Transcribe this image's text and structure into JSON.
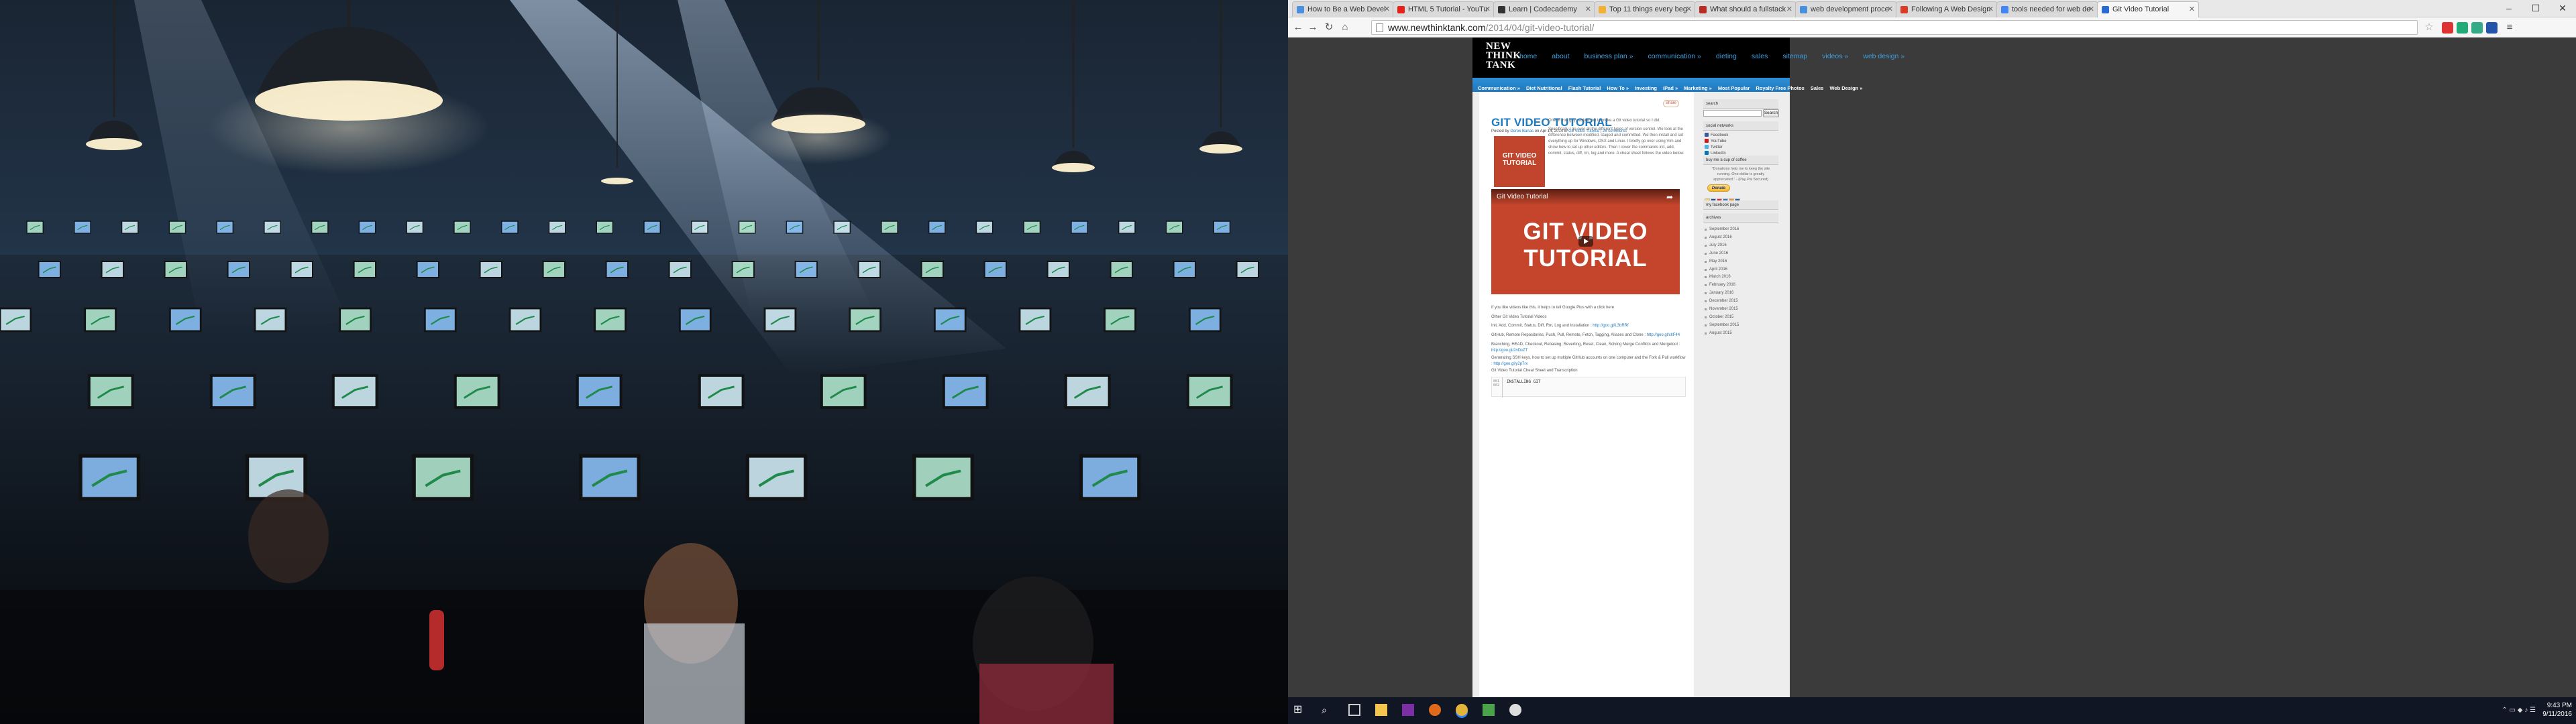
{
  "browser": {
    "tabs": [
      {
        "title": "How to Be a Web Devel",
        "favicon_color": "#4a8fe0"
      },
      {
        "title": "HTML 5 Tutorial - YouTu",
        "favicon_color": "#e62117"
      },
      {
        "title": "Learn | Codecademy",
        "favicon_color": "#333333"
      },
      {
        "title": "Top 11 things every beg",
        "favicon_color": "#f2b134"
      },
      {
        "title": "What should a fullstack",
        "favicon_color": "#b92b27"
      },
      {
        "title": "web development proce",
        "favicon_color": "#4a8fe0"
      },
      {
        "title": "Following A Web Design",
        "favicon_color": "#d93d26"
      },
      {
        "title": "tools needed for web de",
        "favicon_color": "#4285f4"
      },
      {
        "title": "Git Video Tutorial",
        "favicon_color": "#2a6ad6"
      }
    ],
    "url_host": "www.newthinktank.com",
    "url_path": "/2014/04/git-video-tutorial/"
  },
  "site": {
    "logo_lines": [
      "NEW",
      "THINK",
      "TANK"
    ],
    "top_nav": [
      "home",
      "about",
      "business plan »",
      "communication »",
      "dieting",
      "sales",
      "sitemap",
      "videos »",
      "web design »"
    ],
    "sub_nav": [
      "Communication »",
      "Diet Nutritional",
      "Flash Tutorial",
      "How To »",
      "Investing",
      "iPad »",
      "Marketing »",
      "Most Popular",
      "Royalty Free Photos",
      "Sales",
      "Web Design »"
    ],
    "share_label": "Share",
    "post": {
      "title": "GIT VIDEO TUTORIAL",
      "meta_prefix": "Posted by",
      "author": "Derek Banas",
      "meta_date": "on Apr 14, 2014 in",
      "category": "Git Video Tutorial",
      "comments": "| 26 comments",
      "thumb_text": "GIT VIDEO TUTORIAL",
      "intro_1": "One of you guys asked me to make a Git video tutorial so I did.",
      "intro_2": "Specifically I go over all the different types of version control. We look at the difference between modified, staged and committed. We then install and set everything up for Windows, OSX and Linux. I briefly go over using Vim and show how to set up other editors. Then I cover the commands init, add, commit, status, diff, rm, log and more. A cheat sheet follows the video below.",
      "video_title": "Git Video Tutorial",
      "video_big_text": "GIT VIDEO TUTORIAL",
      "google_plus": "If you like videos like this, it helps to tell Google Plus with a click here",
      "other_heading": "Other Git Video Tutorial Videos",
      "links": [
        {
          "text": "Init, Add, Commit, Status, Diff, Rm, Log and Installation :",
          "url": "http://goo.gl/L3bRRf"
        },
        {
          "text": "GitHub, Remote Repositories, Push, Pull, Remote, Fetch, Tagging, Aliases and Clone :",
          "url": "http://goo.gl/cltF44"
        },
        {
          "text": "Branching, HEAD, Checkout, Rebasing, Reverting, Reset, Clean, Solving Merge Conflicts and Mergetool :",
          "url": "http://goo.gl/2nDsZT"
        },
        {
          "text": "Generating SSH keys, how to set up multiple GitHub accounts on one computer and the Fork & Pull workflow :",
          "url": "http://goo.gl/y2p7rx"
        }
      ],
      "cheat_heading": "Git Video Tutorial Cheat Sheet and Transcription",
      "code_gutter": [
        "001",
        "002"
      ],
      "code_line": "INSTALLING GIT"
    },
    "sidebar": {
      "search_head": "search",
      "search_button": "Search",
      "social_head": "social networks",
      "social": [
        {
          "label": "Facebook",
          "color": "#3b5998"
        },
        {
          "label": "YouTube",
          "color": "#cc181e"
        },
        {
          "label": "Twitter",
          "color": "#55acee"
        },
        {
          "label": "LinkedIn",
          "color": "#0077b5"
        }
      ],
      "coffee_head": "buy me a cup of coffee",
      "coffee_text": "\"Donations help me to keep the site running. One dollar is greatly appreciated.\" - (Pay Pal Secured)",
      "donate_label": "Donate",
      "facebook_head": "my facebook page",
      "archives_head": "archives",
      "archives": [
        "September 2016",
        "August 2016",
        "July 2016",
        "June 2016",
        "May 2016",
        "April 2016",
        "March 2016",
        "February 2016",
        "January 2016",
        "December 2015",
        "November 2015",
        "October 2015",
        "September 2015",
        "August 2015"
      ]
    }
  },
  "taskbar": {
    "time": "9:43 PM",
    "date": "9/11/2016"
  }
}
